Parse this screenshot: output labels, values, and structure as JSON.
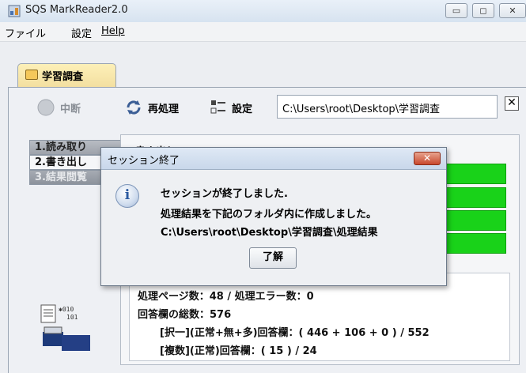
{
  "window": {
    "title": "SQS MarkReader2.0"
  },
  "menubar": {
    "items": [
      "ファイル",
      "設定",
      "Help"
    ]
  },
  "tab": {
    "label": "学習調査"
  },
  "toolbar": {
    "stop_label": "中断",
    "reprocess_label": "再処理",
    "settings_label": "設定",
    "path_value": "C:\\Users\\root\\Desktop\\学習調査"
  },
  "steps": [
    "1.読み取り",
    "2.書き出し",
    "3.結果閲覧"
  ],
  "content": {
    "header": "書き出し"
  },
  "summary": {
    "line1": "処理ページ数：48 / 処理エラー数：0",
    "line2": "回答欄の総数：576",
    "line3": "[択一](正常+無+多)回答欄：( 446 + 106 + 0 ) / 552",
    "line4": "[複数](正常)回答欄：( 15 ) / 24"
  },
  "dialog": {
    "title": "セッション終了",
    "line1": "セッションが終了しました.",
    "line2": "処理結果を下記のフォルダ内に作成しました。",
    "line3": "C:\\Users\\root\\Desktop\\学習調査\\処理結果",
    "ok_label": "了解"
  },
  "colors": {
    "progress_green": "#19d219",
    "dialog_close_red": "#c8472c"
  }
}
